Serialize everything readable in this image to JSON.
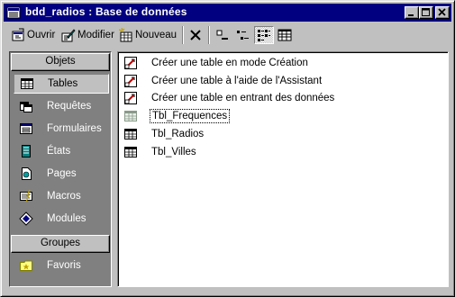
{
  "window": {
    "title": "bdd_radios : Base de données",
    "app_icon": "database-window-icon",
    "caption_buttons": [
      "minimize-icon",
      "maximize-icon",
      "close-icon"
    ]
  },
  "toolbar": {
    "open_label": "Ouvrir",
    "modify_label": "Modifier",
    "new_label": "Nouveau",
    "delete_icon": "delete-x-icon",
    "view_icons": [
      "large-icons-view-icon",
      "small-icons-view-icon",
      "list-view-icon",
      "details-view-icon"
    ],
    "active_view": "list-view-icon"
  },
  "objects_pane": {
    "header": "Objets",
    "items": [
      {
        "label": "Tables",
        "icon": "table-icon",
        "selected": true
      },
      {
        "label": "Requêtes",
        "icon": "query-icon"
      },
      {
        "label": "Formulaires",
        "icon": "form-icon"
      },
      {
        "label": "États",
        "icon": "report-icon"
      },
      {
        "label": "Pages",
        "icon": "page-icon"
      },
      {
        "label": "Macros",
        "icon": "macro-icon"
      },
      {
        "label": "Modules",
        "icon": "module-icon"
      }
    ],
    "groups_header": "Groupes",
    "groups": [
      {
        "label": "Favoris",
        "icon": "favorites-folder-icon"
      }
    ]
  },
  "list": {
    "items": [
      {
        "label": "Créer une table en mode Création",
        "icon": "wizard-shortcut-icon"
      },
      {
        "label": "Créer une table à l'aide de l'Assistant",
        "icon": "wizard-shortcut-icon"
      },
      {
        "label": "Créer une table en entrant des données",
        "icon": "wizard-shortcut-icon"
      },
      {
        "label": "Tbl_Frequences",
        "icon": "table-icon",
        "selected": true
      },
      {
        "label": "Tbl_Radios",
        "icon": "table-icon"
      },
      {
        "label": "Tbl_Villes",
        "icon": "table-icon"
      }
    ]
  }
}
